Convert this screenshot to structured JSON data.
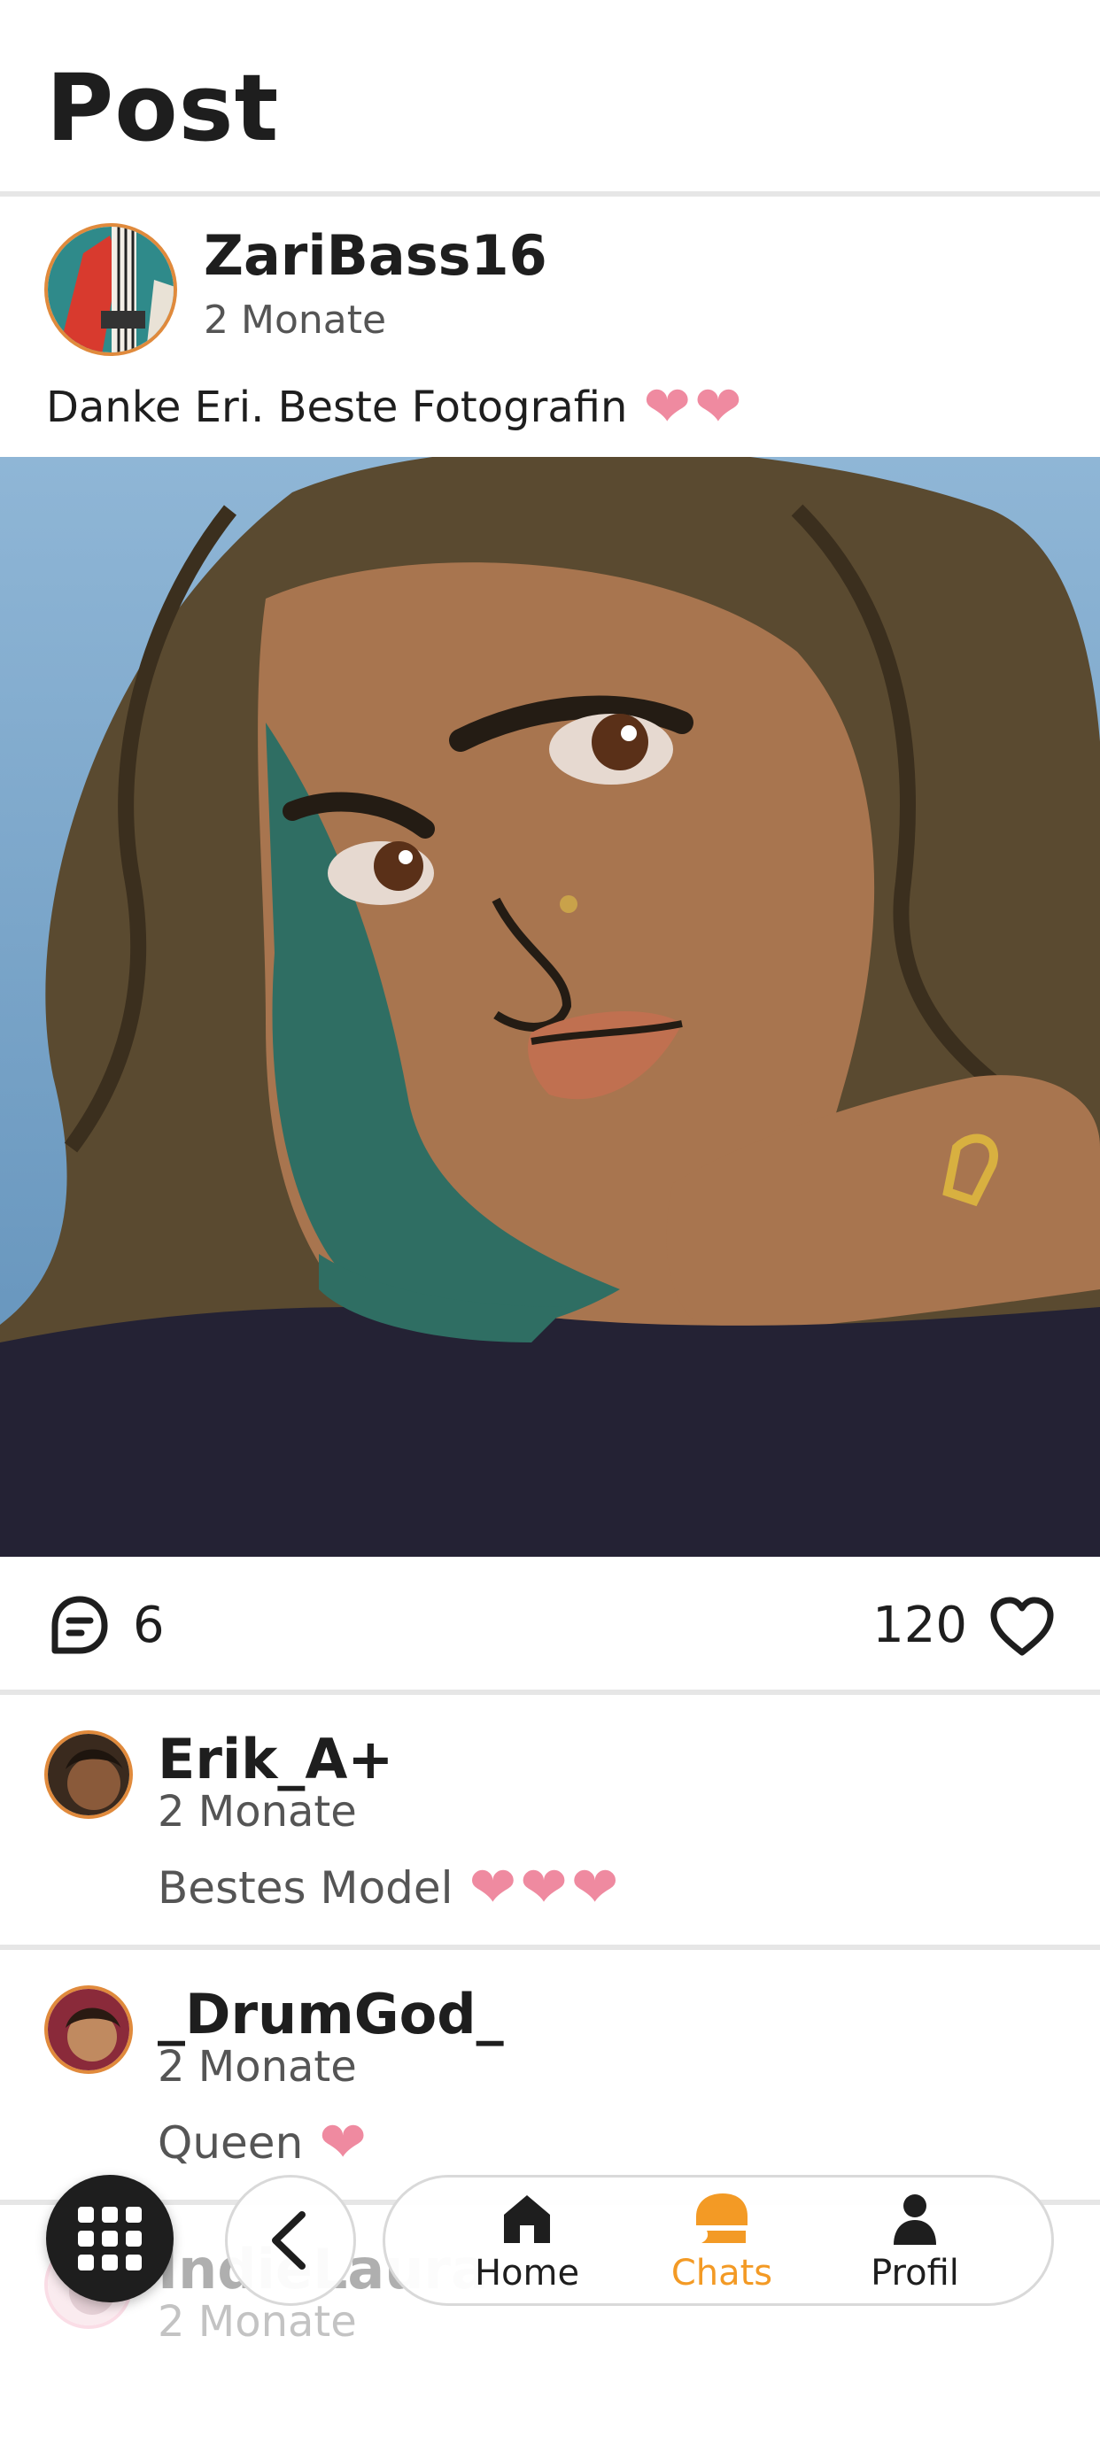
{
  "header": {
    "title": "Post"
  },
  "post": {
    "username": "ZariBass16",
    "time": "2 Monate",
    "caption": "Danke Eri. Beste Fotografin",
    "comment_count": "6",
    "like_count": "120"
  },
  "comments": [
    {
      "username": "Erik_A+",
      "time": "2 Monate",
      "text": "Bestes Model"
    },
    {
      "username": "_DrumGod_",
      "time": "2 Monate",
      "text": "Queen"
    },
    {
      "username": "IndieLaura",
      "time": "2 Monate"
    }
  ],
  "nav": {
    "items": [
      {
        "label": "Home",
        "icon": "home-icon"
      },
      {
        "label": "Chats",
        "icon": "chat-icon",
        "active": true
      },
      {
        "label": "Profil",
        "icon": "person-icon"
      }
    ],
    "active_color": "#f39a25"
  },
  "colors": {
    "accent_border": "#e08a3c",
    "heart": "#ef8aa0",
    "text": "#1e1e1e"
  }
}
